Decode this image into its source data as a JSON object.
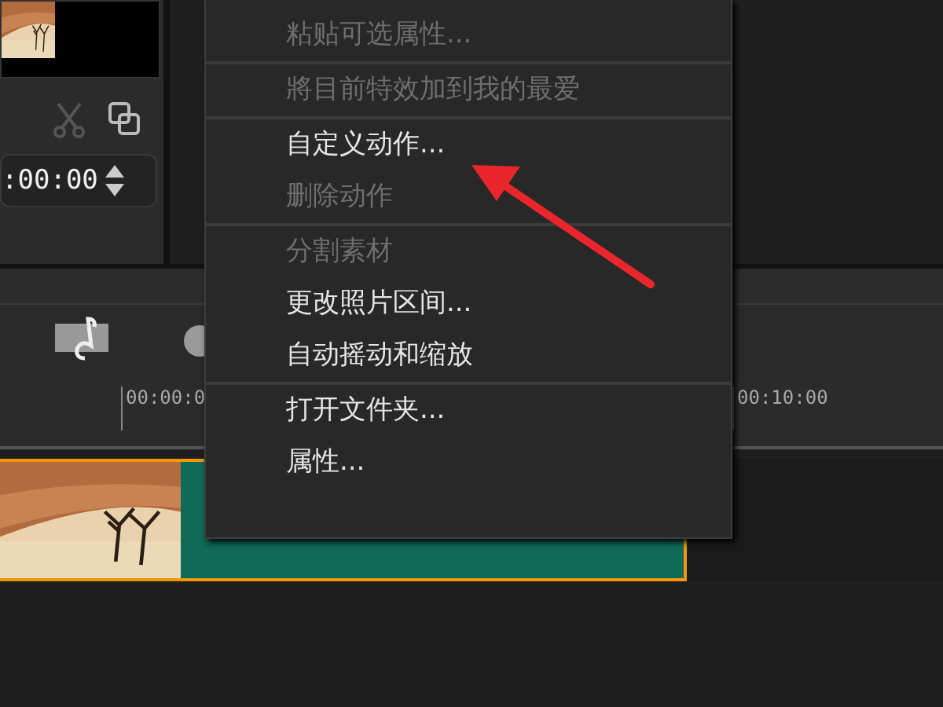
{
  "preview": {
    "timecode": ":00:00"
  },
  "ruler": {
    "labels": [
      "00:00:0",
      "00:10:00"
    ]
  },
  "track": {
    "clip": {
      "kind": "picture",
      "selected": true
    }
  },
  "context_menu": {
    "groups": [
      [
        {
          "label": "粘贴可选属性...",
          "disabled": true
        }
      ],
      [
        {
          "label": "將目前特效加到我的最爱",
          "disabled": true
        }
      ],
      [
        {
          "label": "自定义动作...",
          "disabled": false
        },
        {
          "label": "删除动作",
          "disabled": true
        }
      ],
      [
        {
          "label": "分割素材",
          "disabled": true
        },
        {
          "label": "更改照片区间...",
          "disabled": false
        },
        {
          "label": "自动摇动和缩放",
          "disabled": false
        }
      ],
      [
        {
          "label": "打开文件夹...",
          "disabled": false
        },
        {
          "label": "属性...",
          "disabled": false
        }
      ]
    ]
  }
}
